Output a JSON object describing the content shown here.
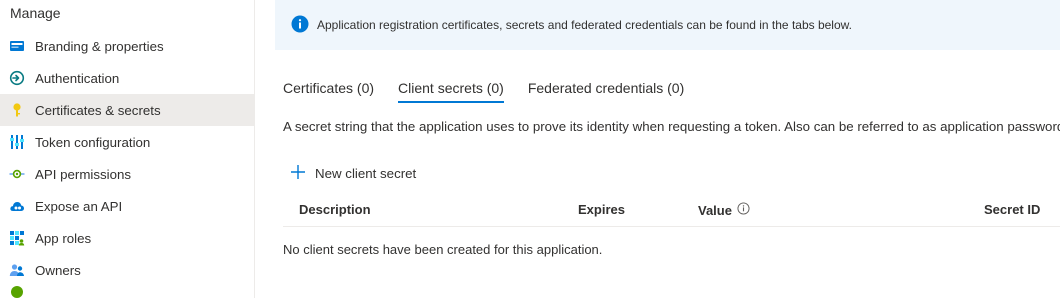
{
  "sidebar": {
    "heading": "Manage",
    "items": [
      {
        "label": "Branding & properties",
        "icon": "branding-icon"
      },
      {
        "label": "Authentication",
        "icon": "authentication-icon"
      },
      {
        "label": "Certificates & secrets",
        "icon": "key-icon"
      },
      {
        "label": "Token configuration",
        "icon": "token-icon"
      },
      {
        "label": "API permissions",
        "icon": "api-permissions-icon"
      },
      {
        "label": "Expose an API",
        "icon": "cloud-icon"
      },
      {
        "label": "App roles",
        "icon": "app-roles-icon"
      },
      {
        "label": "Owners",
        "icon": "owners-icon"
      }
    ],
    "active_index": 2
  },
  "banner": {
    "text": "Application registration certificates, secrets and federated credentials can be found in the tabs below.",
    "icon": "info-icon",
    "color": "#0078d4"
  },
  "tabs": [
    {
      "label": "Certificates (0)"
    },
    {
      "label": "Client secrets (0)",
      "selected": true
    },
    {
      "label": "Federated credentials (0)"
    }
  ],
  "description": "A secret string that the application uses to prove its identity when requesting a token. Also can be referred to as application password.",
  "new_secret_label": "New client secret",
  "table": {
    "columns": [
      "Description",
      "Expires",
      "Value",
      "Secret ID"
    ],
    "empty_message": "No client secrets have been created for this application."
  },
  "colors": {
    "accent": "#0078d4",
    "active_bg": "#edebe9",
    "banner_bg": "#eff6fc"
  }
}
